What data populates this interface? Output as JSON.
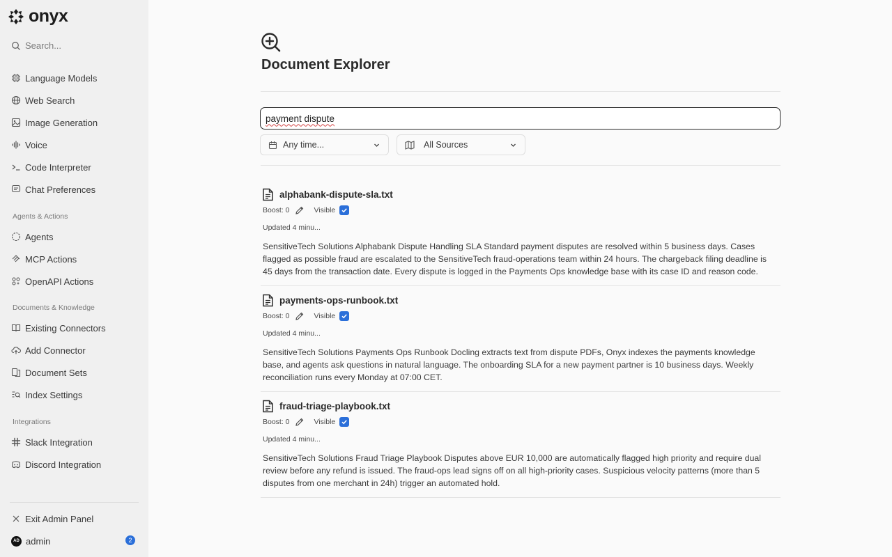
{
  "app": {
    "name": "onyx"
  },
  "sidebar": {
    "search_label": "Search...",
    "top_items": [
      {
        "label": "Language Models",
        "icon": "cpu-icon"
      },
      {
        "label": "Web Search",
        "icon": "globe-icon"
      },
      {
        "label": "Image Generation",
        "icon": "image-icon"
      },
      {
        "label": "Voice",
        "icon": "audio-wave-icon"
      },
      {
        "label": "Code Interpreter",
        "icon": "terminal-icon"
      },
      {
        "label": "Chat Preferences",
        "icon": "chat-icon"
      }
    ],
    "sections": [
      {
        "label": "Agents & Actions",
        "items": [
          {
            "label": "Agents",
            "icon": "circle-dashed-icon"
          },
          {
            "label": "MCP Actions",
            "icon": "mcp-icon"
          },
          {
            "label": "OpenAPI Actions",
            "icon": "openapi-icon"
          }
        ]
      },
      {
        "label": "Documents & Knowledge",
        "items": [
          {
            "label": "Existing Connectors",
            "icon": "book-icon"
          },
          {
            "label": "Add Connector",
            "icon": "cloud-upload-icon"
          },
          {
            "label": "Document Sets",
            "icon": "files-icon"
          },
          {
            "label": "Index Settings",
            "icon": "search-list-icon"
          }
        ]
      },
      {
        "label": "Integrations",
        "items": [
          {
            "label": "Slack Integration",
            "icon": "slack-icon"
          },
          {
            "label": "Discord Integration",
            "icon": "discord-icon"
          }
        ]
      }
    ],
    "exit_label": "Exit Admin Panel",
    "user": {
      "initials": "AD",
      "name": "admin",
      "badge": "2"
    }
  },
  "main": {
    "title": "Document Explorer",
    "search": {
      "value": "payment dispute"
    },
    "filters": {
      "time": "Any time...",
      "sources": "All Sources"
    },
    "results": [
      {
        "title": "alphabank-dispute-sla.txt",
        "boost": "Boost: 0",
        "visible_label": "Visible",
        "updated": "Updated 4 minu...",
        "body": "SensitiveTech Solutions Alphabank Dispute Handling SLA Standard payment disputes are resolved within 5 business days. Cases flagged as possible fraud are escalated to the SensitiveTech fraud-operations team within 24 hours. The chargeback filing deadline is 45 days from the transaction date. Every dispute is logged in the Payments Ops knowledge base with its case ID and reason code."
      },
      {
        "title": "payments-ops-runbook.txt",
        "boost": "Boost: 0",
        "visible_label": "Visible",
        "updated": "Updated 4 minu...",
        "body": "SensitiveTech Solutions Payments Ops Runbook Docling extracts text from dispute PDFs, Onyx indexes the payments knowledge base, and agents ask questions in natural language. The onboarding SLA for a new payment partner is 10 business days. Weekly reconciliation runs every Monday at 07:00 CET."
      },
      {
        "title": "fraud-triage-playbook.txt",
        "boost": "Boost: 0",
        "visible_label": "Visible",
        "updated": "Updated 4 minu...",
        "body": "SensitiveTech Solutions Fraud Triage Playbook Disputes above EUR 10,000 are automatically flagged high priority and require dual review before any refund is issued. The fraud-ops lead signs off on all high-priority cases. Suspicious velocity patterns (more than 5 disputes from one merchant in 24h) trigger an automated hold."
      }
    ]
  }
}
